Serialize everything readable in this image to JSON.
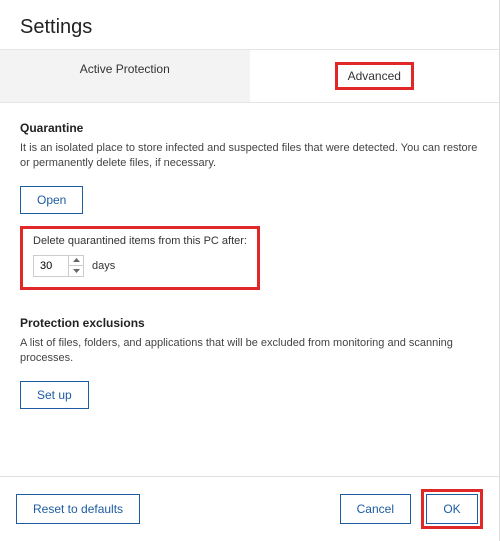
{
  "header": {
    "title": "Settings"
  },
  "tabs": {
    "active_protection": "Active Protection",
    "advanced": "Advanced"
  },
  "quarantine": {
    "title": "Quarantine",
    "desc": "It is an isolated place to store infected and suspected files that were detected. You can restore or permanently delete files, if necessary.",
    "open_btn": "Open",
    "delete_label": "Delete quarantined items from this PC after:",
    "days_value": "30",
    "days_unit": "days"
  },
  "exclusions": {
    "title": "Protection exclusions",
    "desc": "A list of files, folders, and applications that will be excluded from monitoring and scanning processes.",
    "setup_btn": "Set up"
  },
  "footer": {
    "reset": "Reset to defaults",
    "cancel": "Cancel",
    "ok": "OK"
  }
}
